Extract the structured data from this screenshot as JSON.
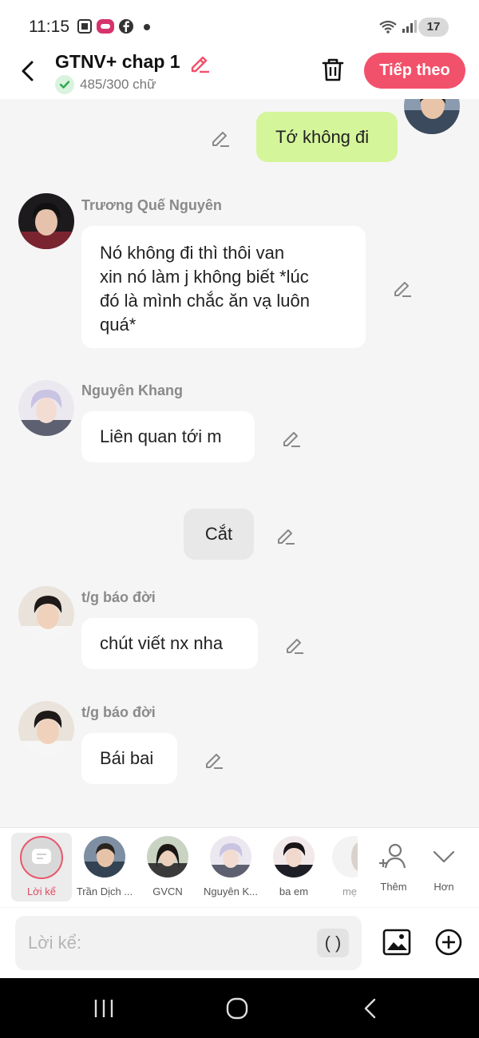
{
  "status_bar": {
    "time": "11:15",
    "battery": "17",
    "icons": [
      "screenshot-icon",
      "lazada-icon",
      "facebook-icon",
      "notification-dot",
      "wifi-icon",
      "signal-icon"
    ]
  },
  "header": {
    "title": "GTNV+ chap 1",
    "word_count": "485/300 chữ",
    "next_button": "Tiếp theo",
    "accent_color": "#f2516b"
  },
  "messages": [
    {
      "type": "me",
      "text": "Tớ không đi"
    },
    {
      "type": "other",
      "sender": "Trương Quế Nguyên",
      "text_lines": [
        "Nó không đi thì thôi van",
        "xin nó làm j không biết *lúc",
        "đó là mình chắc ăn vạ luôn",
        "quá*"
      ]
    },
    {
      "type": "other",
      "sender": "Nguyên Khang",
      "text": "Liên quan tới m"
    },
    {
      "type": "narration",
      "text": "Cắt"
    },
    {
      "type": "other",
      "sender": "t/g báo đời",
      "text": "chút viết nx nha"
    },
    {
      "type": "other",
      "sender": "t/g báo đời",
      "text": "Bái bai"
    }
  ],
  "characters": [
    {
      "label": "Lời kể",
      "selected": true
    },
    {
      "label": "Trần Dịch ..."
    },
    {
      "label": "GVCN"
    },
    {
      "label": "Nguyên K..."
    },
    {
      "label": "ba em"
    },
    {
      "label": "mẹ"
    },
    {
      "label": "Thêm"
    },
    {
      "label": "Hơn"
    }
  ],
  "input": {
    "placeholder": "Lời kể:",
    "paren_label": "( )"
  }
}
